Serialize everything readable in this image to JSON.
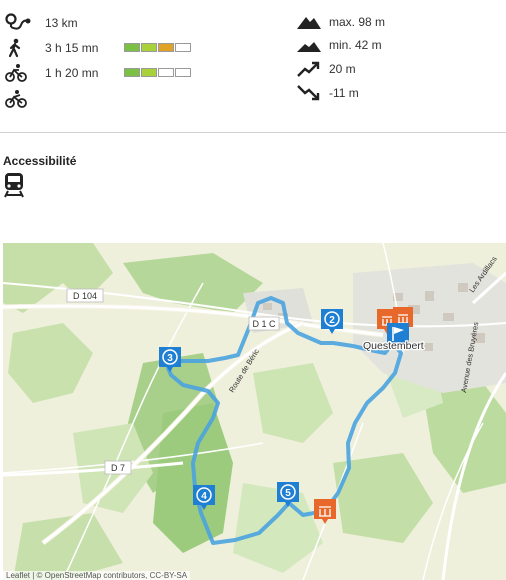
{
  "stats": {
    "distance": "13 km",
    "walk_time": "3 h 15 mn",
    "bike_time": "1 h 20 mn",
    "alt_max": "max. 98 m",
    "alt_min": "min. 42 m",
    "climb": "20 m",
    "descent": "-11 m",
    "walk_difficulty": {
      "level": 3,
      "of": 4,
      "colors": [
        "#7cc144",
        "#a9d23a",
        "#e0a227"
      ]
    },
    "bike_difficulty": {
      "level": 2,
      "of": 4,
      "colors": [
        "#7cc144",
        "#a9d23a"
      ]
    }
  },
  "icons": {
    "distance": "route-distance-icon",
    "walk": "hiker-icon",
    "bike": "bicycle-icon",
    "bike2": "mountain-bike-icon",
    "max": "mountain-peak-icon",
    "min": "mountain-low-icon",
    "climb": "ascent-arrow-icon",
    "descent": "descent-arrow-icon",
    "train": "train-icon"
  },
  "accessibility": {
    "title": "Accessibilité"
  },
  "map": {
    "labels": {
      "d104": "D 104",
      "d1c": "D 1 C",
      "d7": "D 7",
      "route_beric": "Route de Béric",
      "town": "Questembert",
      "ardillacs": "Les Ardillacs",
      "bruyeres": "Avenue des Bruyères"
    },
    "markers": [
      "2",
      "3",
      "4",
      "5"
    ],
    "route_color": "#4aa3df",
    "marker_color": "#1e7fd3",
    "poi_color": "#e8672a",
    "attribution": "Leaflet | © OpenStreetMap contributors, CC-BY-SA"
  }
}
